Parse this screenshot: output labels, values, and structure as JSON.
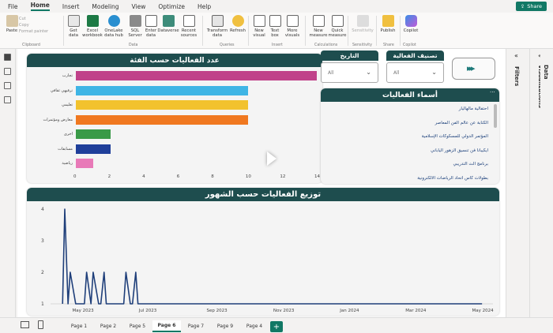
{
  "menu": {
    "items": [
      "File",
      "Home",
      "Insert",
      "Modeling",
      "View",
      "Optimize",
      "Help"
    ],
    "share": "Share"
  },
  "ribbon": {
    "clipboard": {
      "paste": "Paste",
      "cut": "Cut",
      "copy": "Copy",
      "format_painter": "Format painter",
      "group": "Clipboard"
    },
    "data": {
      "get_data": "Get\ndata",
      "excel": "Excel\nworkbook",
      "onelake": "OneLake\ndata hub",
      "sql": "SQL\nServer",
      "enter": "Enter\ndata",
      "dataverse": "Dataverse",
      "recent": "Recent\nsources",
      "group": "Data"
    },
    "queries": {
      "transform": "Transform\ndata",
      "refresh": "Refresh",
      "group": "Queries"
    },
    "insert": {
      "new_visual": "New\nvisual",
      "text_box": "Text\nbox",
      "more_visuals": "More\nvisuals",
      "group": "Insert"
    },
    "calculations": {
      "new_measure": "New\nmeasure",
      "quick_measure": "Quick\nmeasure",
      "group": "Calculations"
    },
    "sensitivity": {
      "label": "Sensitivity",
      "group": "Sensitivity"
    },
    "share": {
      "publish": "Publish",
      "group": "Share"
    },
    "copilot": {
      "label": "Copilot",
      "group": "Copilot"
    }
  },
  "bar_panel": {
    "title": "عدد الفعاليات حسب الفئة"
  },
  "chart_data": [
    {
      "type": "bar",
      "orientation": "horizontal",
      "title": "عدد الفعاليات حسب الفئة",
      "categories": [
        "تجارب",
        "ترفيهي ثقافي",
        "تعليمي",
        "معارض ومؤتمرات",
        "اخرى",
        "مسابقات",
        "رياضية"
      ],
      "values": [
        14,
        10,
        10,
        10,
        2,
        2,
        1
      ],
      "colors": [
        "#c0428a",
        "#3fb5e5",
        "#f2c22e",
        "#f07820",
        "#3a9a48",
        "#1f3f9a",
        "#e87ab8"
      ],
      "xlim": [
        0,
        14
      ],
      "xticks": [
        "0",
        "2",
        "4",
        "6",
        "8",
        "10",
        "12",
        "14"
      ]
    },
    {
      "type": "line",
      "title": "توزيع الفعاليات حسب الشهور",
      "x": [
        "2023-04-12",
        "2023-04-14",
        "2023-04-17",
        "2023-04-19",
        "2023-04-24",
        "2023-05-02",
        "2023-05-04",
        "2023-05-08",
        "2023-05-10",
        "2023-05-15",
        "2023-05-17",
        "2023-05-20",
        "2023-05-22",
        "2023-06-07",
        "2023-06-09",
        "2023-06-13",
        "2023-06-15",
        "2023-06-18",
        "2023-06-20",
        "2023-06-22",
        "2024-04-30"
      ],
      "y": [
        1,
        4,
        1,
        2,
        1,
        1,
        2,
        1,
        2,
        1,
        1,
        2,
        1,
        1,
        2,
        1,
        1,
        2,
        1,
        1,
        1
      ],
      "xticks": [
        "May 2023",
        "Jul 2023",
        "Sep 2023",
        "Nov 2023",
        "Jan 2024",
        "Mar 2024",
        "May 2024"
      ],
      "yticks": [
        "1",
        "2",
        "3",
        "4"
      ],
      "ylim": [
        1,
        4
      ],
      "color": "#1f3f7a"
    }
  ],
  "slicers": {
    "category": {
      "title": "تصنيف الفعالية",
      "value": "All"
    },
    "date": {
      "title": "التاريخ",
      "value": "All"
    }
  },
  "names_panel": {
    "title": "أسماء الفعاليات",
    "items": [
      "احتفالية مالهاليار",
      "الكتابة عن عالم الفن المعاصر",
      "المؤتمر الدولي للمسكوكات الإسلامية",
      "ايكيبانا فن تنسيق الزهور الياباني",
      "برنامج الث التدريبي",
      "بطولات كاس اتحاد الرياضات الالكترونية"
    ]
  },
  "line_panel": {
    "title": "توزيع الفعاليات حسب الشهور"
  },
  "panes": {
    "filters": "Filters",
    "visualizations": "Visualizations",
    "data": "Data"
  },
  "tabs": [
    "Page 1",
    "Page 2",
    "Page 5",
    "Page 6",
    "Page 7",
    "Page 9",
    "Page 4"
  ],
  "active_tab": "Page 6"
}
